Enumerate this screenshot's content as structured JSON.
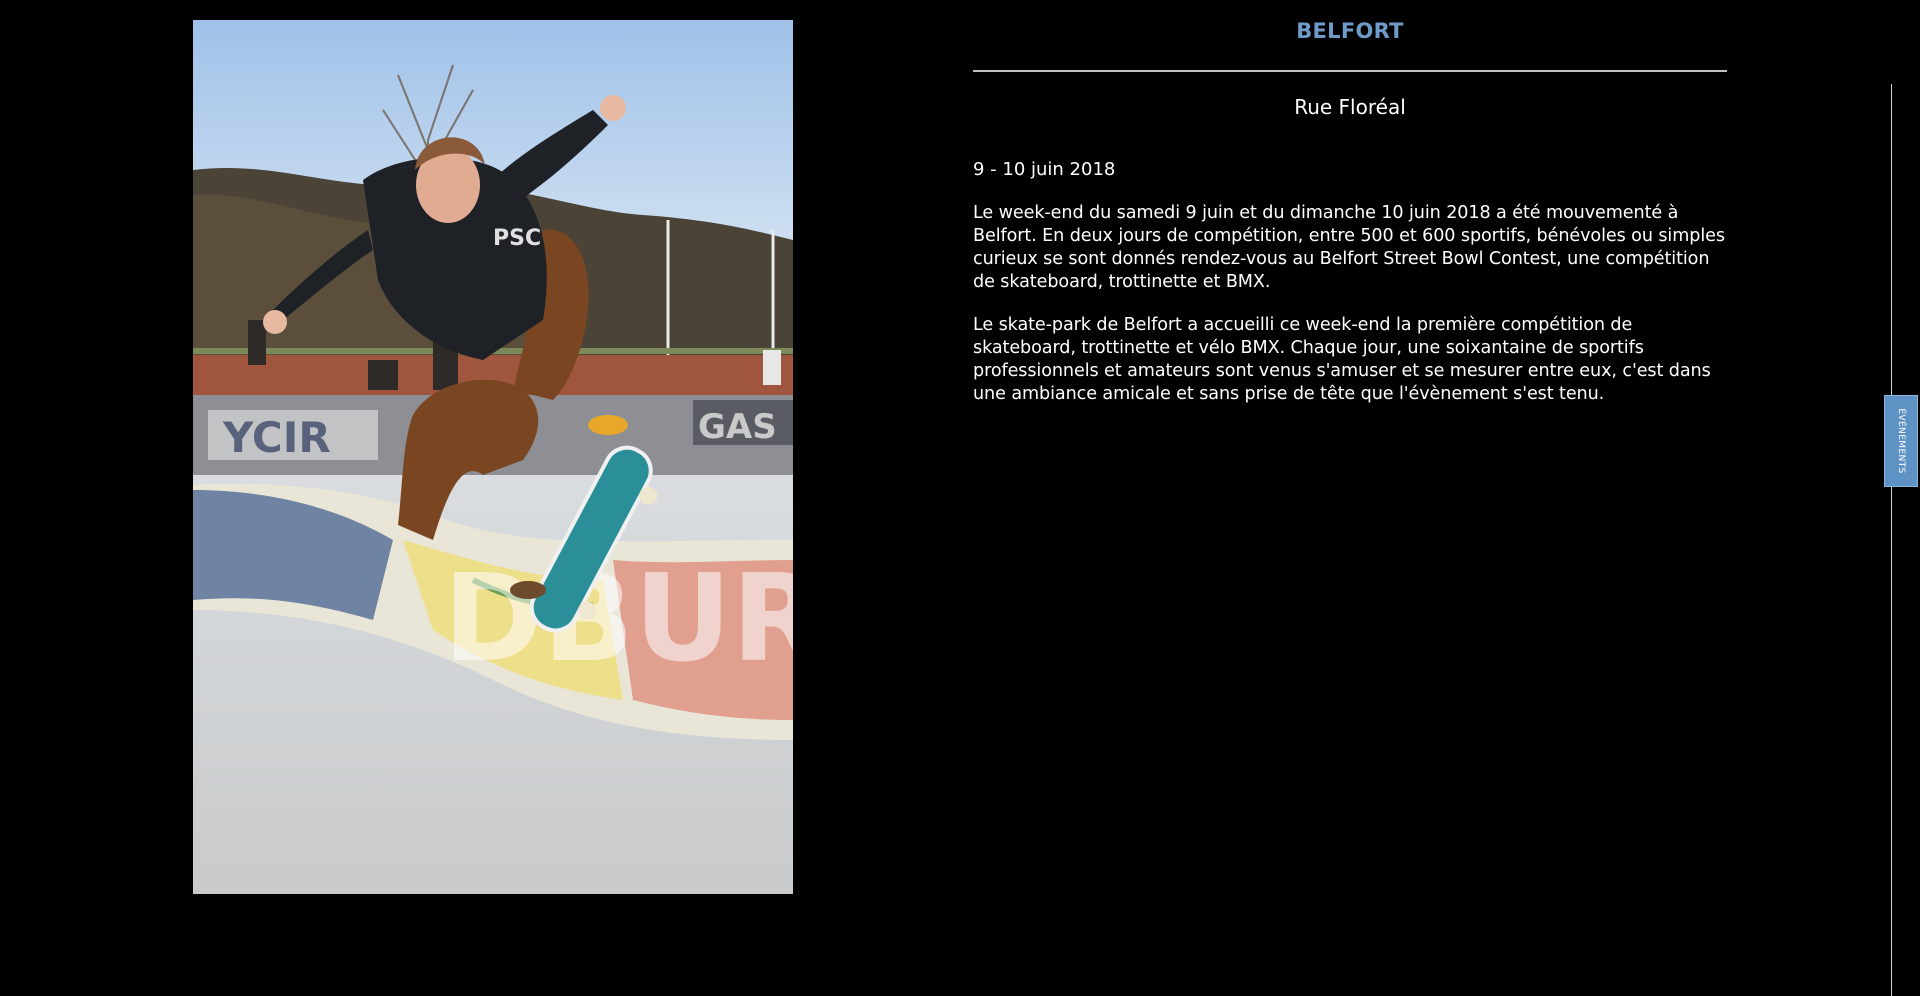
{
  "event": {
    "city": "BELFORT",
    "address": "Rue Floréal",
    "dates": "9 - 10 juin 2018",
    "paragraphs": [
      "Le week-end du samedi 9 juin et du dimanche 10 juin 2018 a été mouvementé à Belfort. En deux jours de compétition, entre 500 et 600 sportifs, bénévoles ou simples curieux se sont donnés rendez-vous au Belfort Street Bowl Contest, une compétition de skateboard, trottinette et BMX.",
      "Le skate-park de Belfort a accueilli ce week-end la première compétition de skateboard, trottinette et vélo BMX. Chaque jour, une soixantaine de sportifs professionnels et amateurs sont venus s'amuser et se mesurer entre eux, c'est dans une ambiance amicale et sans prise de tête que l'évènement s'est tenu."
    ]
  },
  "side_tab": {
    "label": "ÉVÉNEMENTS"
  },
  "colors": {
    "background": "#000000",
    "accent": "#6f9bc9",
    "tab": "#5f93c6",
    "text": "#ffffff"
  }
}
